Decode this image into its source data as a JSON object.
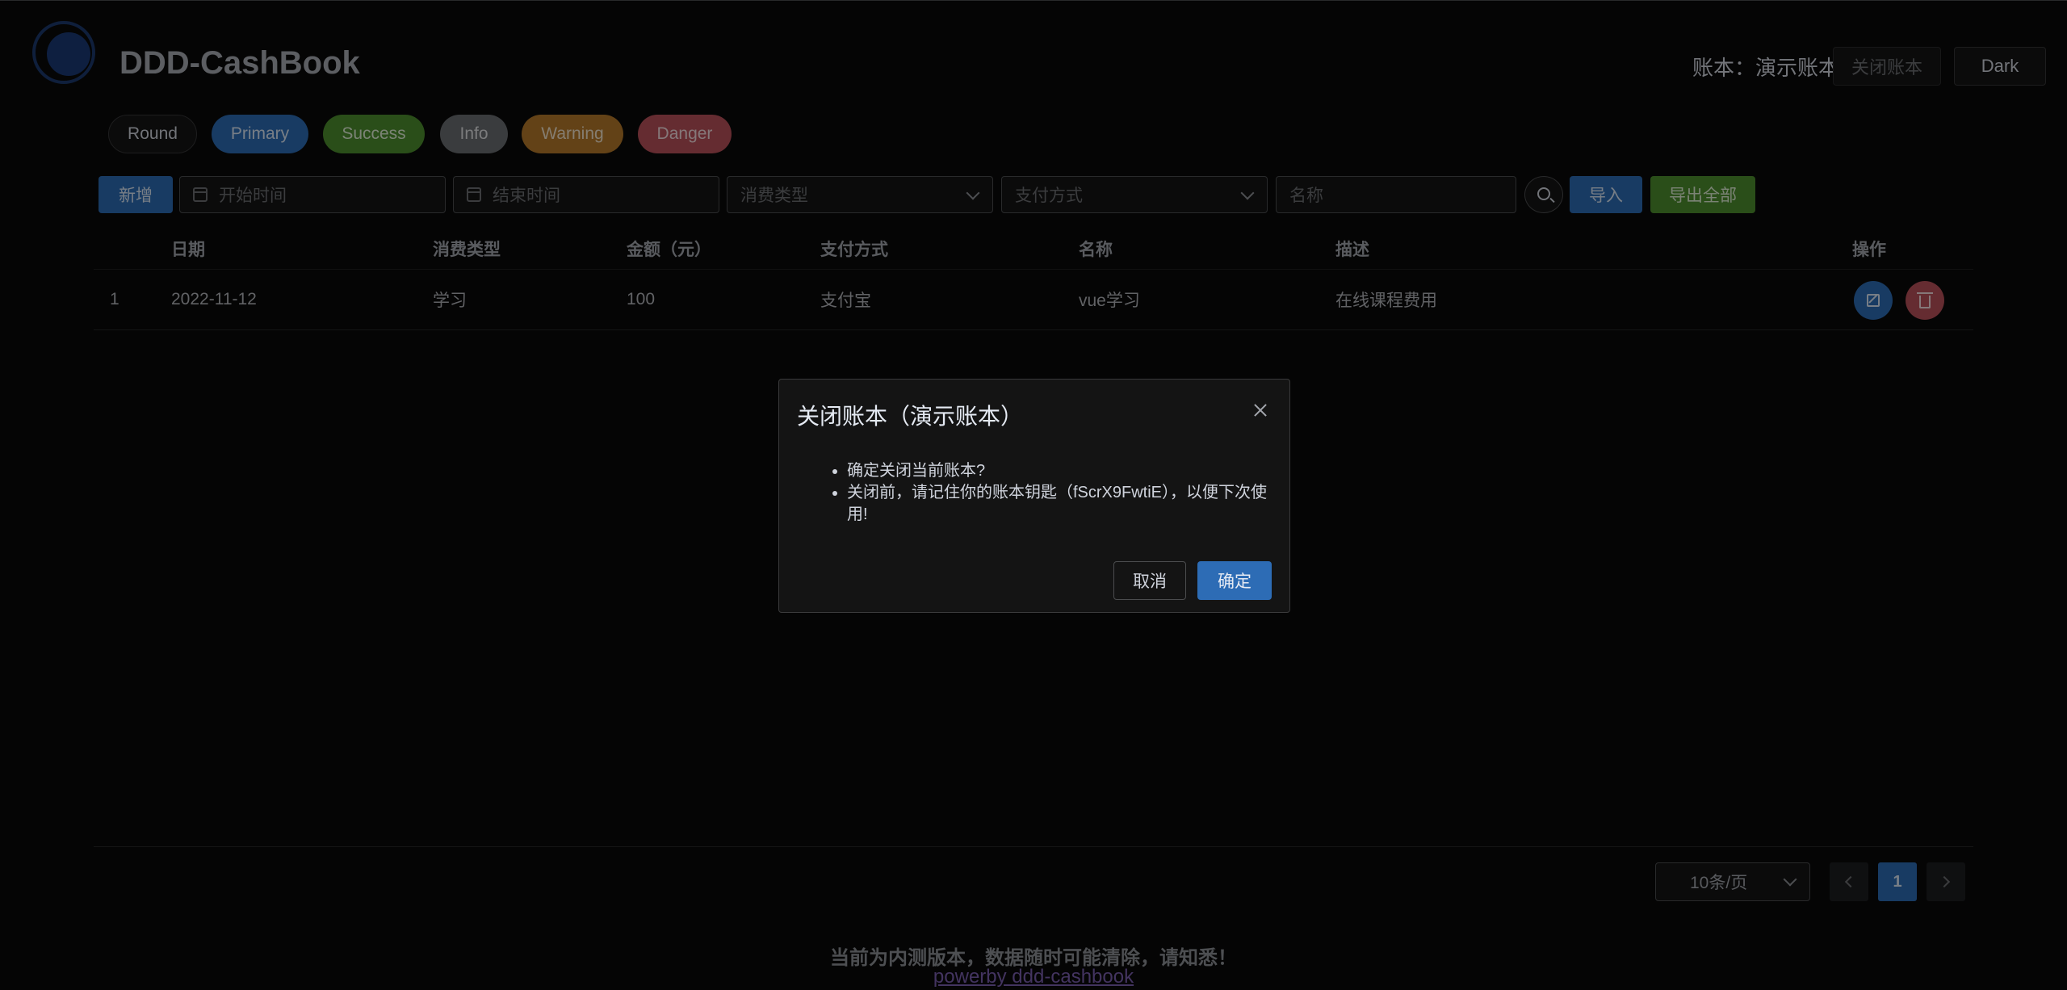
{
  "app": {
    "title": "DDD-CashBook"
  },
  "header": {
    "account_label": "账本：演示账本",
    "close_book_label": "关闭账本",
    "dark_label": "Dark"
  },
  "pills": {
    "round": "Round",
    "primary": "Primary",
    "success": "Success",
    "info": "Info",
    "warning": "Warning",
    "danger": "Danger"
  },
  "toolbar": {
    "add_label": "新增",
    "start_placeholder": "开始时间",
    "end_placeholder": "结束时间",
    "type_placeholder": "消费类型",
    "pay_placeholder": "支付方式",
    "name_placeholder": "名称",
    "import_label": "导入",
    "export_label": "导出全部"
  },
  "table": {
    "headers": [
      "",
      "日期",
      "消费类型",
      "金额（元）",
      "支付方式",
      "名称",
      "描述",
      "操作"
    ],
    "rows": [
      {
        "index": "1",
        "date": "2022-11-12",
        "type": "学习",
        "amount": "100",
        "payment": "支付宝",
        "name": "vue学习",
        "desc": "在线课程费用"
      }
    ]
  },
  "pagination": {
    "page_size": "10条/页",
    "current_page": "1"
  },
  "footer": {
    "notice": "当前为内测版本，数据随时可能清除，请知悉！",
    "powered": "powerby ddd-cashbook"
  },
  "dialog": {
    "title": "关闭账本（演示账本）",
    "items": [
      "确定关闭当前账本?",
      "关闭前，请记住你的账本钥匙（fScrX9FwtiE），以便下次使用!"
    ],
    "cancel_label": "取消",
    "confirm_label": "确定"
  },
  "colors": {
    "primary": "#2d6cb5",
    "success": "#4e8e2f",
    "info": "#6b6d71",
    "warning": "#b5792a",
    "danger": "#b8505a"
  }
}
